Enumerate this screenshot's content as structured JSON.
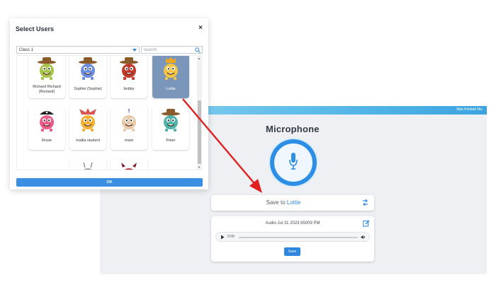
{
  "dialog": {
    "title": "Select Users",
    "close_label": "×",
    "class_select": {
      "value": "Class 1"
    },
    "search": {
      "placeholder": "search"
    },
    "ok_label": "OK",
    "users": [
      {
        "name": "Richard Richard (Richard)",
        "color": "#a7c44a",
        "hat": "cowboy",
        "selected": false
      },
      {
        "name": "Sophie (Sophie)",
        "color": "#6a8de0",
        "hat": "cowboy",
        "selected": false
      },
      {
        "name": "bobby",
        "color": "#c0392b",
        "hat": "cowboy",
        "selected": false
      },
      {
        "name": "Lottie",
        "color": "#f4c542",
        "hat": "crown",
        "selected": true
      },
      {
        "name": "Rosie",
        "color": "#e85c8a",
        "hat": "pirate",
        "selected": false
      },
      {
        "name": "mallia student",
        "color": "#f2b134",
        "hat": "jester",
        "selected": false
      },
      {
        "name": "mark",
        "color": "#e8c9a8",
        "hat": "unicorn",
        "selected": false
      },
      {
        "name": "Peter",
        "color": "#4fb3a9",
        "hat": "cowboy",
        "selected": false
      },
      {
        "name": "",
        "color": "#9aa3ad",
        "hat": "antenna",
        "selected": false
      },
      {
        "name": "",
        "color": "#b4323f",
        "hat": "horns",
        "selected": false
      }
    ]
  },
  "mic_page": {
    "user_label": "Max Kimball 2bc",
    "title": "Microphone",
    "save_to_prefix": "Save to",
    "save_to_target": "Lottie",
    "audio_title": "Audio Jul 31 2023 65009 PM",
    "player_time": "0:00",
    "save_button": "Save"
  },
  "colors": {
    "accent": "#2f86e0",
    "arrow": "#e02020",
    "selected_card": "#7b96bb"
  },
  "icons": [
    "close-icon",
    "chevron-down-icon",
    "search-icon",
    "microphone-icon",
    "swap-icon",
    "edit-icon",
    "play-icon",
    "volume-icon"
  ]
}
